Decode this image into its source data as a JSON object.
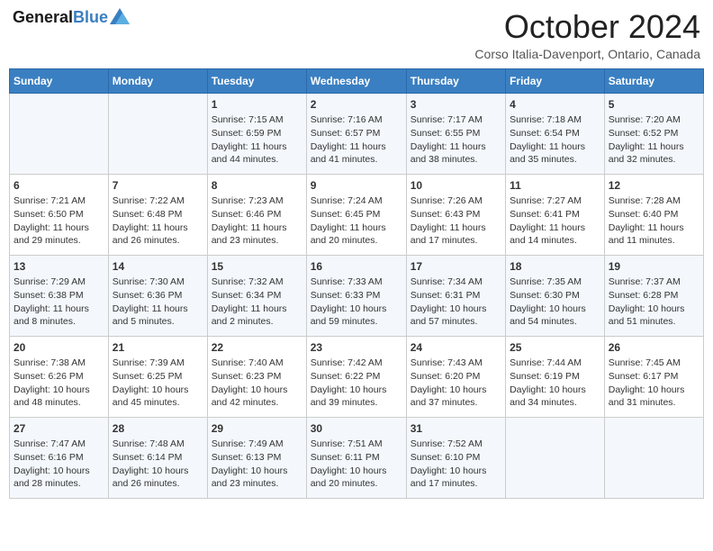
{
  "header": {
    "logo_line1": "General",
    "logo_line2": "Blue",
    "month": "October 2024",
    "location": "Corso Italia-Davenport, Ontario, Canada"
  },
  "days_of_week": [
    "Sunday",
    "Monday",
    "Tuesday",
    "Wednesday",
    "Thursday",
    "Friday",
    "Saturday"
  ],
  "weeks": [
    [
      {
        "day": "",
        "content": ""
      },
      {
        "day": "",
        "content": ""
      },
      {
        "day": "1",
        "content": "Sunrise: 7:15 AM\nSunset: 6:59 PM\nDaylight: 11 hours and 44 minutes."
      },
      {
        "day": "2",
        "content": "Sunrise: 7:16 AM\nSunset: 6:57 PM\nDaylight: 11 hours and 41 minutes."
      },
      {
        "day": "3",
        "content": "Sunrise: 7:17 AM\nSunset: 6:55 PM\nDaylight: 11 hours and 38 minutes."
      },
      {
        "day": "4",
        "content": "Sunrise: 7:18 AM\nSunset: 6:54 PM\nDaylight: 11 hours and 35 minutes."
      },
      {
        "day": "5",
        "content": "Sunrise: 7:20 AM\nSunset: 6:52 PM\nDaylight: 11 hours and 32 minutes."
      }
    ],
    [
      {
        "day": "6",
        "content": "Sunrise: 7:21 AM\nSunset: 6:50 PM\nDaylight: 11 hours and 29 minutes."
      },
      {
        "day": "7",
        "content": "Sunrise: 7:22 AM\nSunset: 6:48 PM\nDaylight: 11 hours and 26 minutes."
      },
      {
        "day": "8",
        "content": "Sunrise: 7:23 AM\nSunset: 6:46 PM\nDaylight: 11 hours and 23 minutes."
      },
      {
        "day": "9",
        "content": "Sunrise: 7:24 AM\nSunset: 6:45 PM\nDaylight: 11 hours and 20 minutes."
      },
      {
        "day": "10",
        "content": "Sunrise: 7:26 AM\nSunset: 6:43 PM\nDaylight: 11 hours and 17 minutes."
      },
      {
        "day": "11",
        "content": "Sunrise: 7:27 AM\nSunset: 6:41 PM\nDaylight: 11 hours and 14 minutes."
      },
      {
        "day": "12",
        "content": "Sunrise: 7:28 AM\nSunset: 6:40 PM\nDaylight: 11 hours and 11 minutes."
      }
    ],
    [
      {
        "day": "13",
        "content": "Sunrise: 7:29 AM\nSunset: 6:38 PM\nDaylight: 11 hours and 8 minutes."
      },
      {
        "day": "14",
        "content": "Sunrise: 7:30 AM\nSunset: 6:36 PM\nDaylight: 11 hours and 5 minutes."
      },
      {
        "day": "15",
        "content": "Sunrise: 7:32 AM\nSunset: 6:34 PM\nDaylight: 11 hours and 2 minutes."
      },
      {
        "day": "16",
        "content": "Sunrise: 7:33 AM\nSunset: 6:33 PM\nDaylight: 10 hours and 59 minutes."
      },
      {
        "day": "17",
        "content": "Sunrise: 7:34 AM\nSunset: 6:31 PM\nDaylight: 10 hours and 57 minutes."
      },
      {
        "day": "18",
        "content": "Sunrise: 7:35 AM\nSunset: 6:30 PM\nDaylight: 10 hours and 54 minutes."
      },
      {
        "day": "19",
        "content": "Sunrise: 7:37 AM\nSunset: 6:28 PM\nDaylight: 10 hours and 51 minutes."
      }
    ],
    [
      {
        "day": "20",
        "content": "Sunrise: 7:38 AM\nSunset: 6:26 PM\nDaylight: 10 hours and 48 minutes."
      },
      {
        "day": "21",
        "content": "Sunrise: 7:39 AM\nSunset: 6:25 PM\nDaylight: 10 hours and 45 minutes."
      },
      {
        "day": "22",
        "content": "Sunrise: 7:40 AM\nSunset: 6:23 PM\nDaylight: 10 hours and 42 minutes."
      },
      {
        "day": "23",
        "content": "Sunrise: 7:42 AM\nSunset: 6:22 PM\nDaylight: 10 hours and 39 minutes."
      },
      {
        "day": "24",
        "content": "Sunrise: 7:43 AM\nSunset: 6:20 PM\nDaylight: 10 hours and 37 minutes."
      },
      {
        "day": "25",
        "content": "Sunrise: 7:44 AM\nSunset: 6:19 PM\nDaylight: 10 hours and 34 minutes."
      },
      {
        "day": "26",
        "content": "Sunrise: 7:45 AM\nSunset: 6:17 PM\nDaylight: 10 hours and 31 minutes."
      }
    ],
    [
      {
        "day": "27",
        "content": "Sunrise: 7:47 AM\nSunset: 6:16 PM\nDaylight: 10 hours and 28 minutes."
      },
      {
        "day": "28",
        "content": "Sunrise: 7:48 AM\nSunset: 6:14 PM\nDaylight: 10 hours and 26 minutes."
      },
      {
        "day": "29",
        "content": "Sunrise: 7:49 AM\nSunset: 6:13 PM\nDaylight: 10 hours and 23 minutes."
      },
      {
        "day": "30",
        "content": "Sunrise: 7:51 AM\nSunset: 6:11 PM\nDaylight: 10 hours and 20 minutes."
      },
      {
        "day": "31",
        "content": "Sunrise: 7:52 AM\nSunset: 6:10 PM\nDaylight: 10 hours and 17 minutes."
      },
      {
        "day": "",
        "content": ""
      },
      {
        "day": "",
        "content": ""
      }
    ]
  ]
}
